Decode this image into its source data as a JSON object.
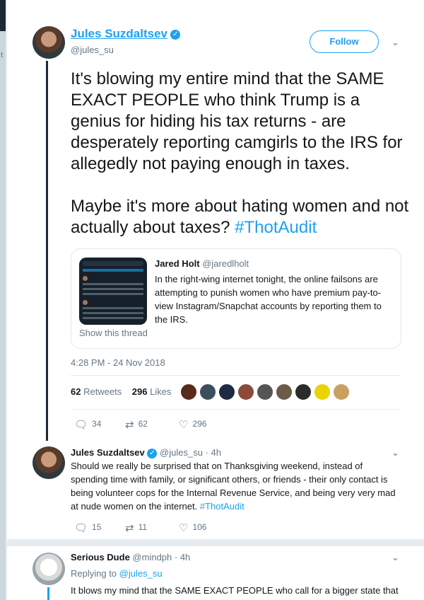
{
  "main_tweet": {
    "display_name": "Jules Suzdaltsev",
    "handle": "@jules_su",
    "follow_label": "Follow",
    "text_p1": "It's blowing my entire mind that the SAME EXACT PEOPLE who think Trump is a genius for hiding his tax returns - are desperately reporting camgirls to the IRS for allegedly not paying enough in taxes.",
    "text_p2": "Maybe it's more about hating women and not actually about taxes?",
    "hashtag": "#ThotAudit",
    "quote": {
      "name": "Jared Holt",
      "handle": "@jaredlholt",
      "text": "In the right-wing internet tonight, the online failsons are attempting to punish women who have premium pay-to-view Instagram/Snapchat accounts by reporting them to the IRS.",
      "show_thread": "Show this thread"
    },
    "timestamp": "4:28 PM - 24 Nov 2018",
    "retweets_count": "62",
    "retweets_label": "Retweets",
    "likes_count": "296",
    "likes_label": "Likes",
    "replies": "34",
    "retweets": "62",
    "likes": "296"
  },
  "reply1": {
    "display_name": "Jules Suzdaltsev",
    "handle": "@jules_su",
    "time": "· 4h",
    "text": "Should we really be surprised that on Thanksgiving weekend, instead of spending time with family, or significant others, or friends - their only contact is being volunteer cops for the Internal Revenue Service, and being very very mad at nude women on the internet.",
    "hashtag": "#ThotAudit",
    "replies": "15",
    "retweets": "11",
    "likes": "106"
  },
  "reply2": {
    "display_name": "Serious Dude",
    "handle": "@mindph",
    "time": "· 4h",
    "replying_label": "Replying to",
    "replying_handle": "@jules_su",
    "text": "It blows my mind that the SAME EXACT PEOPLE who call for a bigger state that"
  },
  "icons": {
    "reply": "reply-icon",
    "retweet": "retweet-icon",
    "like": "heart-icon",
    "verified": "verified-badge-icon",
    "menu": "chevron-down-icon"
  },
  "colors": {
    "accent": "#1da1f2",
    "text": "#14171a",
    "muted": "#657786",
    "thread_line": "#1b2836"
  },
  "left_fragment": "t"
}
